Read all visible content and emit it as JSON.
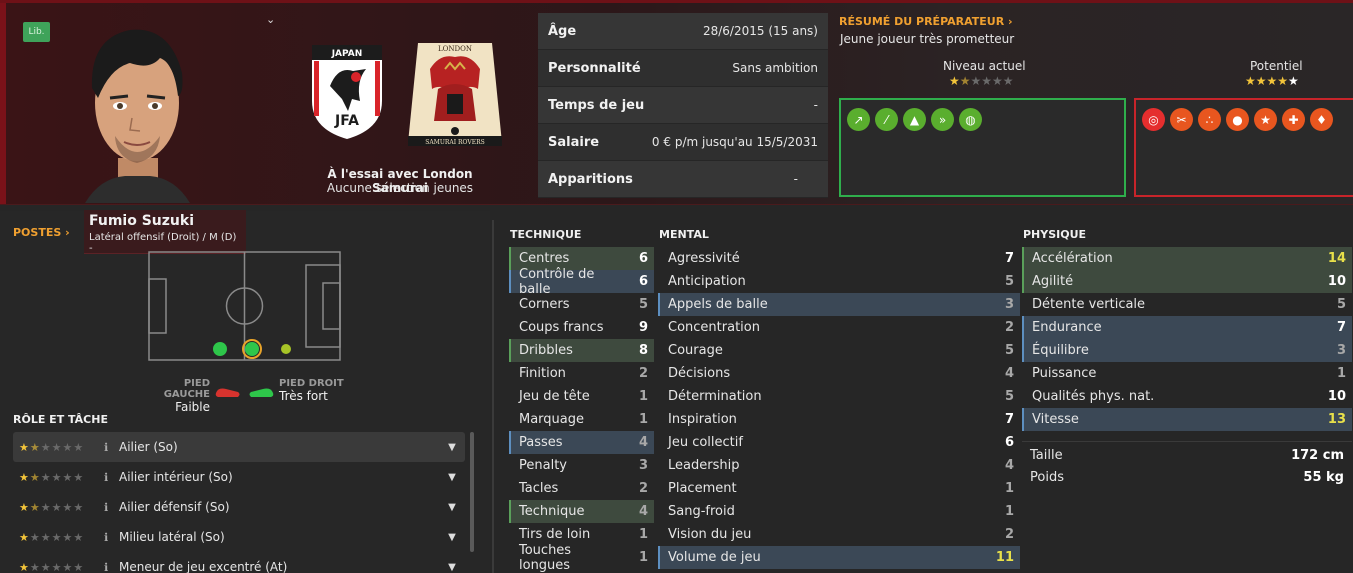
{
  "header": {
    "lib_badge": "Lib.",
    "trial_line": "À l'essai avec London Samurai",
    "selection_line": "Aucune sélection jeunes",
    "flag_text_top": "JAPAN",
    "flag_text_bottom": "JFA",
    "crest_text_top": "LONDON",
    "crest_text_bottom": "SAMURAI ROVERS"
  },
  "info": [
    {
      "label": "Âge",
      "value": "28/6/2015 (15 ans)"
    },
    {
      "label": "Personnalité",
      "value": "Sans ambition"
    },
    {
      "label": "Temps de jeu",
      "value": "-"
    },
    {
      "label": "Salaire",
      "value": "0 € p/m jusqu'au 15/5/2031"
    },
    {
      "label": "Apparitions",
      "value": "-"
    }
  ],
  "coach": {
    "title": "RÉSUMÉ DU PRÉPARATEUR ›",
    "text": "Jeune joueur très prometteur",
    "current_label": "Niveau actuel",
    "current_stars": 1.5,
    "potential_label": "Potentiel",
    "potential_stars": 4.5
  },
  "positions": {
    "link": "POSTES ›",
    "player_name": "Fumio Suzuki",
    "position_text": "Latéral offensif (Droit) / M (D) -"
  },
  "feet": {
    "left_label": "PIED GAUCHE",
    "left_value": "Faible",
    "right_label": "PIED DROIT",
    "right_value": "Très fort"
  },
  "roles": {
    "title": "RÔLE ET TÂCHE",
    "items": [
      {
        "stars": "★½☆☆☆☆",
        "name": "Ailier (So)"
      },
      {
        "stars": "★½☆☆☆☆",
        "name": "Ailier intérieur (So)"
      },
      {
        "stars": "★½☆☆☆☆",
        "name": "Ailier défensif (So)"
      },
      {
        "stars": "★☆☆☆☆",
        "name": "Milieu latéral (So)"
      },
      {
        "stars": "★☆☆☆☆",
        "name": "Meneur de jeu excentré (At)"
      }
    ]
  },
  "technique": {
    "title": "TECHNIQUE",
    "rows": [
      {
        "name": "Centres",
        "value": "6",
        "hl": "g"
      },
      {
        "name": "Contrôle de balle",
        "value": "6",
        "hl": "b"
      },
      {
        "name": "Corners",
        "value": "5",
        "hl": ""
      },
      {
        "name": "Coups francs",
        "value": "9",
        "hl": ""
      },
      {
        "name": "Dribbles",
        "value": "8",
        "hl": "g"
      },
      {
        "name": "Finition",
        "value": "2",
        "hl": ""
      },
      {
        "name": "Jeu de tête",
        "value": "1",
        "hl": ""
      },
      {
        "name": "Marquage",
        "value": "1",
        "hl": ""
      },
      {
        "name": "Passes",
        "value": "4",
        "hl": "b"
      },
      {
        "name": "Penalty",
        "value": "3",
        "hl": ""
      },
      {
        "name": "Tacles",
        "value": "2",
        "hl": ""
      },
      {
        "name": "Technique",
        "value": "4",
        "hl": "g"
      },
      {
        "name": "Tirs de loin",
        "value": "1",
        "hl": ""
      },
      {
        "name": "Touches longues",
        "value": "1",
        "hl": ""
      }
    ]
  },
  "mental": {
    "title": "MENTAL",
    "rows": [
      {
        "name": "Agressivité",
        "value": "7",
        "hl": ""
      },
      {
        "name": "Anticipation",
        "value": "5",
        "hl": ""
      },
      {
        "name": "Appels de balle",
        "value": "3",
        "hl": "b"
      },
      {
        "name": "Concentration",
        "value": "2",
        "hl": ""
      },
      {
        "name": "Courage",
        "value": "5",
        "hl": ""
      },
      {
        "name": "Décisions",
        "value": "4",
        "hl": ""
      },
      {
        "name": "Détermination",
        "value": "5",
        "hl": ""
      },
      {
        "name": "Inspiration",
        "value": "7",
        "hl": ""
      },
      {
        "name": "Jeu collectif",
        "value": "6",
        "hl": ""
      },
      {
        "name": "Leadership",
        "value": "4",
        "hl": ""
      },
      {
        "name": "Placement",
        "value": "1",
        "hl": ""
      },
      {
        "name": "Sang-froid",
        "value": "1",
        "hl": ""
      },
      {
        "name": "Vision du jeu",
        "value": "2",
        "hl": ""
      },
      {
        "name": "Volume de jeu",
        "value": "11",
        "hl": "b"
      }
    ]
  },
  "physique": {
    "title": "PHYSIQUE",
    "rows": [
      {
        "name": "Accélération",
        "value": "14",
        "hl": "g"
      },
      {
        "name": "Agilité",
        "value": "10",
        "hl": "g"
      },
      {
        "name": "Détente verticale",
        "value": "5",
        "hl": ""
      },
      {
        "name": "Endurance",
        "value": "7",
        "hl": "b"
      },
      {
        "name": "Équilibre",
        "value": "3",
        "hl": "b"
      },
      {
        "name": "Puissance",
        "value": "1",
        "hl": ""
      },
      {
        "name": "Qualités phys. nat.",
        "value": "10",
        "hl": ""
      },
      {
        "name": "Vitesse",
        "value": "13",
        "hl": "b"
      }
    ],
    "height_label": "Taille",
    "height_value": "172 cm",
    "weight_label": "Poids",
    "weight_value": "55 kg"
  },
  "colors": {
    "accent_orange": "#f0a030",
    "green_box": "#2fae4c",
    "red_box": "#c8242a",
    "highlight_green": "#3e4a3e",
    "highlight_blue": "#3b4856"
  }
}
